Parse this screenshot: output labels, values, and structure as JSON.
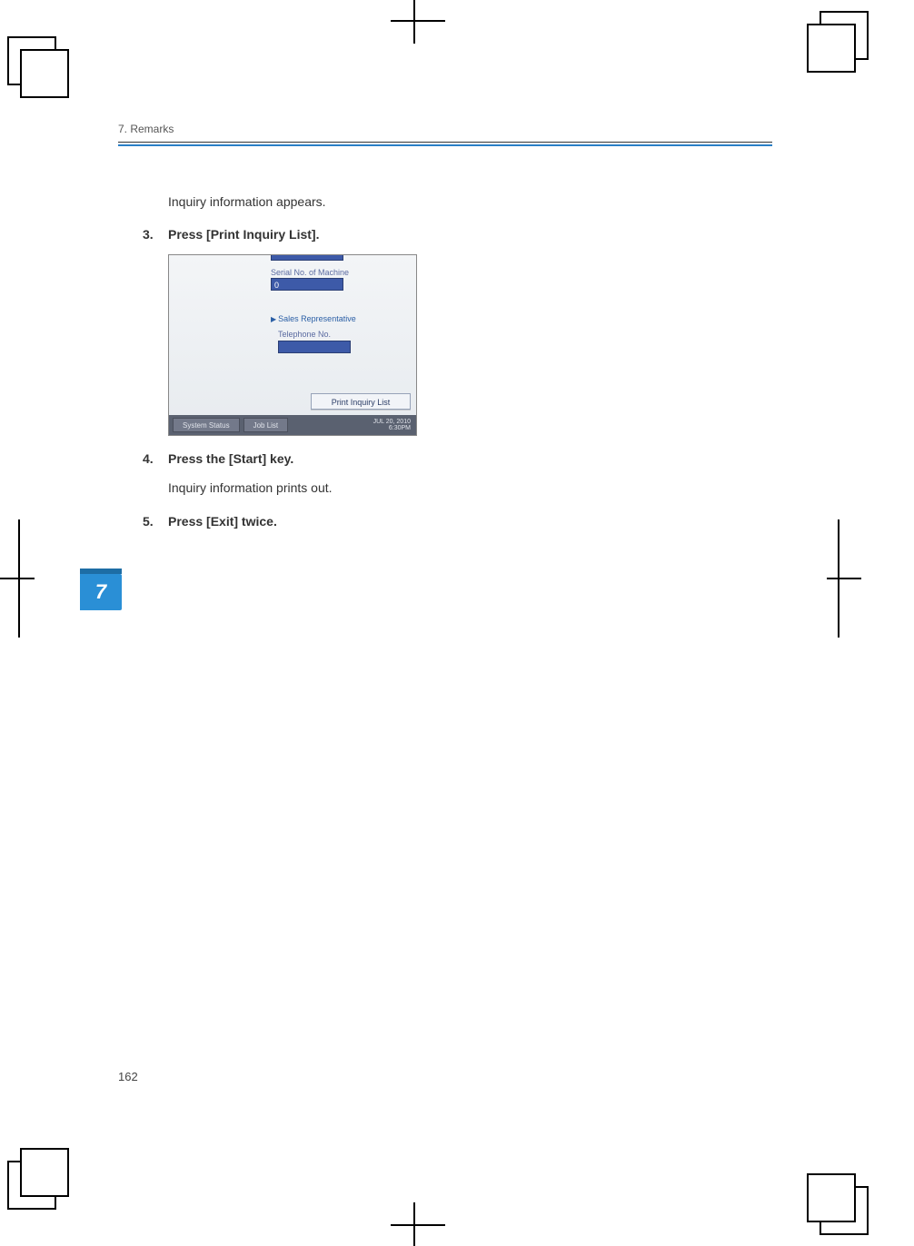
{
  "header": {
    "running": "7. Remarks"
  },
  "intro": "Inquiry information appears.",
  "steps": [
    {
      "n": "3.",
      "title": "Press [Print Inquiry List]."
    },
    {
      "n": "4.",
      "title": "Press the [Start] key.",
      "sub": "Inquiry information prints out."
    },
    {
      "n": "5.",
      "title": "Press [Exit] twice."
    }
  ],
  "device": {
    "serial_label": "Serial No. of Machine",
    "serial_value": "0",
    "sales_rep": "Sales Representative",
    "tel_label": "Telephone No.",
    "print_btn": "Print Inquiry List",
    "tab_system": "System Status",
    "tab_joblist": "Job List",
    "date": "JUL   20, 2010",
    "time": "6:30PM"
  },
  "chapter_tab": "7",
  "page_number": "162"
}
